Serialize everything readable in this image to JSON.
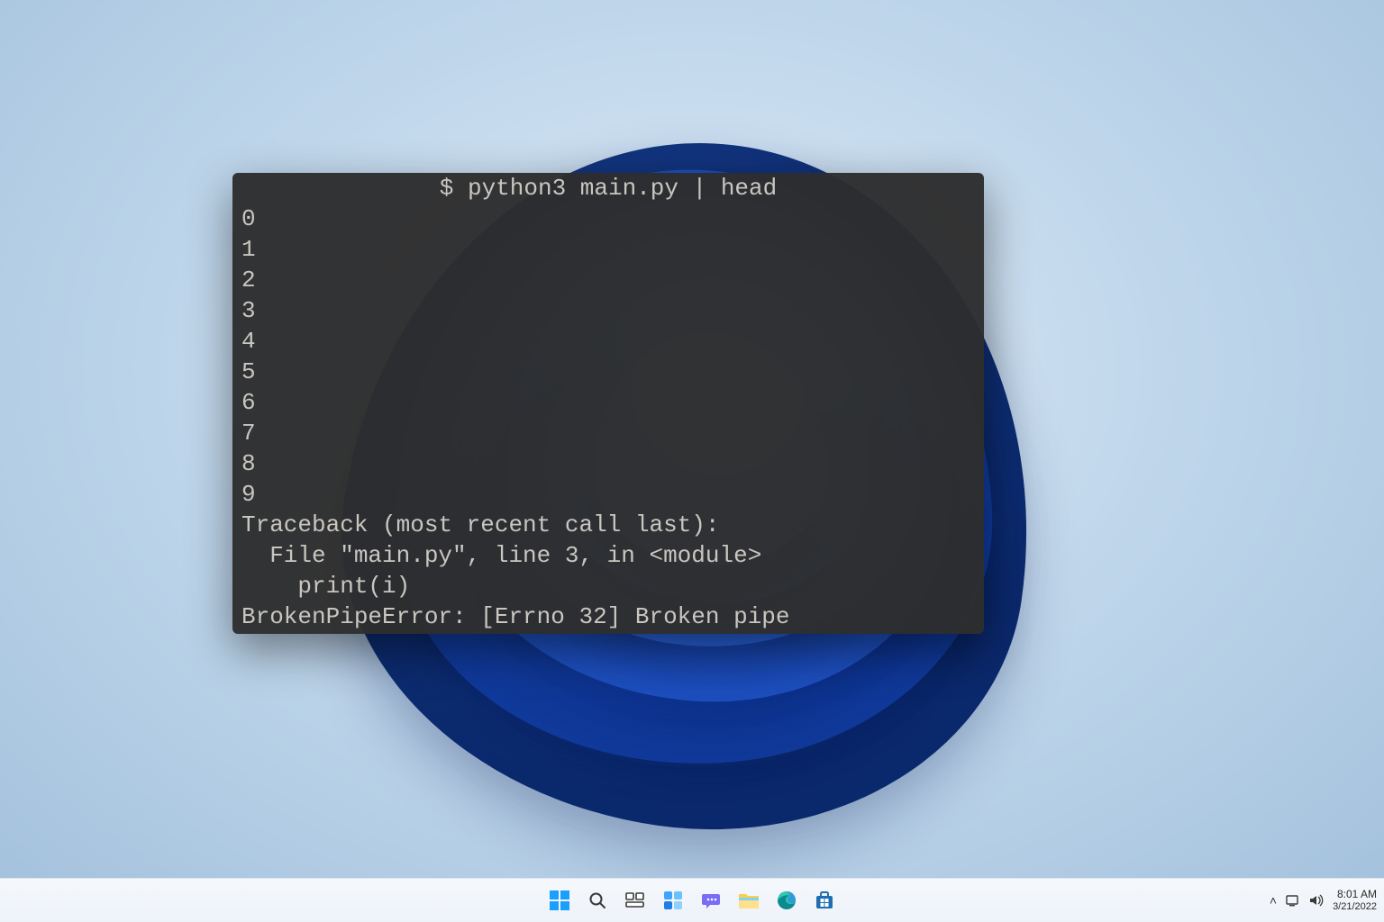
{
  "terminal": {
    "command": "$ python3 main.py | head",
    "output_numbers": [
      "0",
      "1",
      "2",
      "3",
      "4",
      "5",
      "6",
      "7",
      "8",
      "9"
    ],
    "traceback": {
      "header": "Traceback (most recent call last):",
      "file_line": "  File \"main.py\", line 3, in <module>",
      "code_line": "    print(i)",
      "error": "BrokenPipeError: [Errno 32] Broken pipe"
    }
  },
  "taskbar": {
    "icons": {
      "start": "start-icon",
      "search": "search-icon",
      "task_view": "task-view-icon",
      "widgets": "widgets-icon",
      "chat": "chat-icon",
      "explorer": "file-explorer-icon",
      "edge": "edge-icon",
      "store": "microsoft-store-icon"
    }
  },
  "tray": {
    "chevron": "˄",
    "time": "8:01 AM",
    "date": "3/21/2022"
  }
}
